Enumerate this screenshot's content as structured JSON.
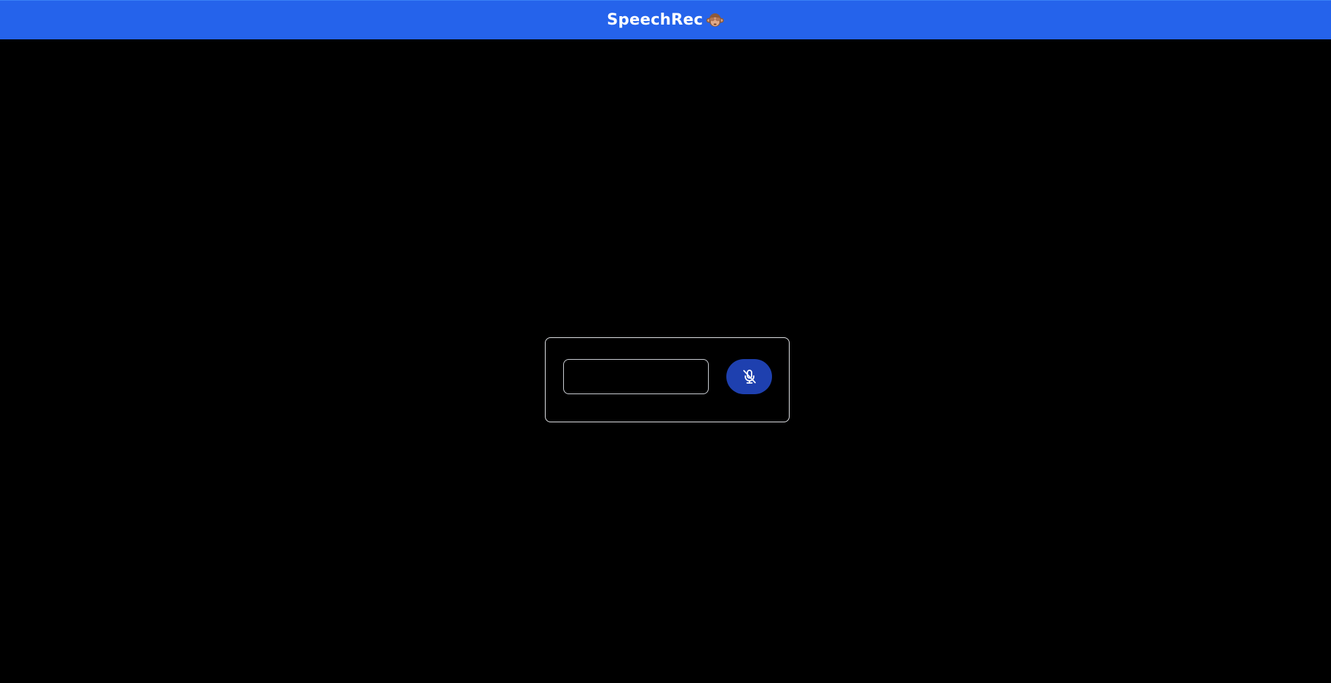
{
  "app": {
    "title": "SpeechRec",
    "logo_icon": "monkey-see-no-evil-icon"
  },
  "speech_panel": {
    "transcript_input": {
      "value": "",
      "placeholder": ""
    },
    "mic_button": {
      "icon": "mic-off-icon",
      "state": "muted"
    }
  },
  "colors": {
    "header_bg": "#2563eb",
    "background": "#000000",
    "mic_button_bg": "#1e40af",
    "border": "#e5e7eb"
  }
}
